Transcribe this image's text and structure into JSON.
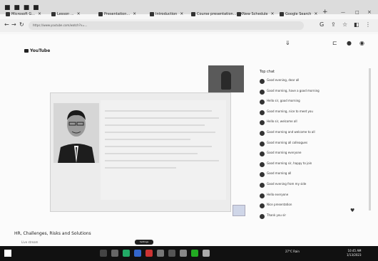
{
  "browser": {
    "tabs": [
      {
        "label": "Microsoft G..."
      },
      {
        "label": "Lesson ..."
      },
      {
        "label": "Presentation..."
      },
      {
        "label": "Introduction"
      },
      {
        "label": "Course presentation..."
      },
      {
        "label": "New Schedule"
      },
      {
        "label": "Google Search"
      }
    ],
    "url": "https://www.youtube.com/watch?v=..."
  },
  "site": {
    "logo": "YouTube"
  },
  "chat": {
    "title": "Top chat",
    "messages": [
      "Good evening, dear all",
      "Good morning, have a good morning",
      "Hello sir, good morning",
      "Good morning, nice to meet you",
      "Hello sir, welcome all",
      "Good morning and welcome to all",
      "Good morning all colleagues",
      "Good morning everyone",
      "Good morning sir, happy to join",
      "Good morning all",
      "Good evening from my side",
      "Hello everyone",
      "Nice presentation",
      "Thank you sir"
    ]
  },
  "video": {
    "control_label": "Settings"
  },
  "caption": {
    "title": "HR, Challenges, Risks and Solutions",
    "subtitle": "Live stream"
  },
  "taskbar": {
    "tray_text": "27°C Rain",
    "time": "10:45 AM",
    "date": "1/13/2023"
  }
}
